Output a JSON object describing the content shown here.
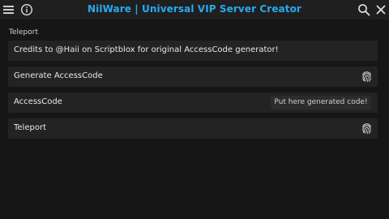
{
  "window": {
    "title": "NilWare | Universal VIP Server Creator"
  },
  "icons": {
    "menu": "hamburger-menu",
    "info": "info-circle",
    "search": "magnifier",
    "close": "x-cross",
    "action": "fingerprint"
  },
  "colors": {
    "accent": "#29a9ee",
    "background": "#161616",
    "row": "#232323",
    "input": "#2c2c2c"
  },
  "tab": {
    "section_label": "Teleport",
    "rows": [
      {
        "type": "label",
        "text": "Credits to @Haii on Scriptblox for original AccessCode generator!"
      },
      {
        "type": "button",
        "text": "Generate AccessCode"
      },
      {
        "type": "textbox",
        "text": "AccessCode",
        "placeholder": "Put here generated code!"
      },
      {
        "type": "button",
        "text": "Teleport"
      }
    ]
  }
}
